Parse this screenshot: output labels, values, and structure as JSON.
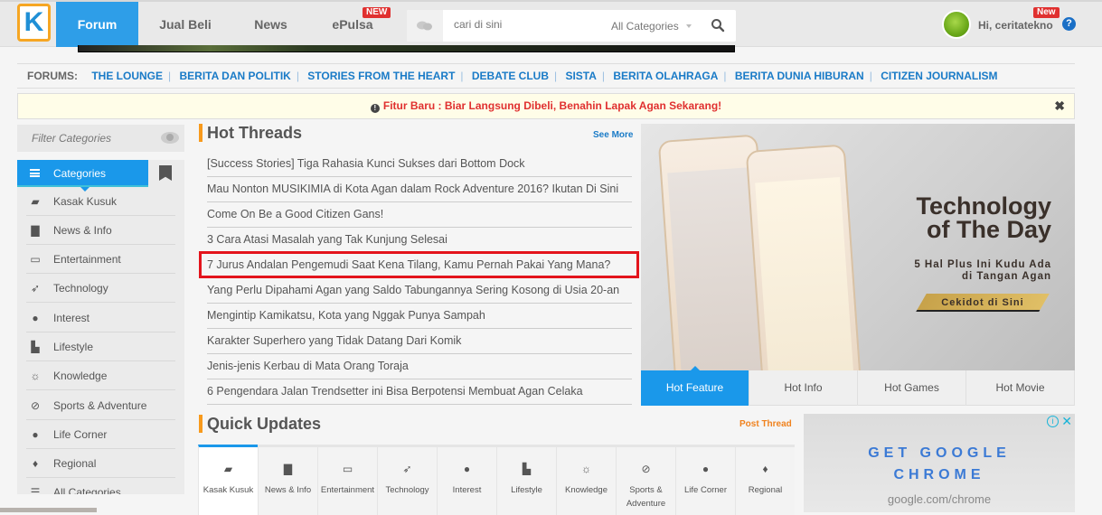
{
  "header": {
    "logo": "K",
    "nav": [
      {
        "label": "Forum",
        "active": true
      },
      {
        "label": "Jual Beli"
      },
      {
        "label": "News"
      },
      {
        "label": "ePulsa",
        "badge": "NEW"
      }
    ],
    "search": {
      "placeholder": "cari di sini",
      "category": "All Categories"
    },
    "user": {
      "greeting": "Hi, ceritatekno",
      "badge": "New",
      "help": "?"
    }
  },
  "forums": {
    "label": "FORUMS:",
    "links": [
      "THE LOUNGE",
      "BERITA DAN POLITIK",
      "STORIES FROM THE HEART",
      "DEBATE CLUB",
      "SISTA",
      "BERITA OLAHRAGA",
      "BERITA DUNIA HIBURAN",
      "CITIZEN JOURNALISM"
    ]
  },
  "notice": {
    "text": "Fitur Baru : Biar Langsung Dibeli, Benahin Lapak Agan Sekarang!",
    "close": "✖"
  },
  "sidebar": {
    "filter_placeholder": "Filter Categories",
    "header": "Categories",
    "items": [
      {
        "label": "Kasak Kusuk",
        "icon": "chat-icon"
      },
      {
        "label": "News & Info",
        "icon": "briefcase-icon"
      },
      {
        "label": "Entertainment",
        "icon": "tv-icon"
      },
      {
        "label": "Technology",
        "icon": "rocket-icon"
      },
      {
        "label": "Interest",
        "icon": "palette-icon"
      },
      {
        "label": "Lifestyle",
        "icon": "hat-icon"
      },
      {
        "label": "Knowledge",
        "icon": "lightbulb-icon"
      },
      {
        "label": "Sports & Adventure",
        "icon": "compass-icon"
      },
      {
        "label": "Life Corner",
        "icon": "apple-icon"
      },
      {
        "label": "Regional",
        "icon": "map-pin-icon"
      },
      {
        "label": "All Categories",
        "icon": "list-icon"
      }
    ]
  },
  "hot_threads": {
    "title": "Hot Threads",
    "see_more": "See More",
    "items": [
      "[Success Stories] Tiga Rahasia Kunci Sukses dari Bottom Dock",
      "Mau Nonton MUSIKIMIA di Kota Agan dalam Rock Adventure 2016? Ikutan Di Sini",
      "Come On Be a Good Citizen Gans!",
      "3 Cara Atasi Masalah yang Tak Kunjung Selesai",
      "7 Jurus Andalan Pengemudi Saat Kena Tilang, Kamu Pernah Pakai Yang Mana?",
      "Yang Perlu Dipahami Agan yang Saldo Tabungannya Sering Kosong di Usia 20-an",
      "Mengintip Kamikatsu, Kota yang Nggak Punya Sampah",
      "Karakter Superhero yang Tidak Datang Dari Komik",
      "Jenis-jenis Kerbau di Mata Orang Toraja",
      "6 Pengendara Jalan Trendsetter ini Bisa Berpotensi Membuat Agan Celaka"
    ],
    "highlighted_index": 4
  },
  "hero": {
    "title_line1": "Technology",
    "title_line2": "of The Day",
    "subtitle_line1": "5 Hal Plus Ini Kudu Ada",
    "subtitle_line2": "di Tangan Agan",
    "cta": "Cekidot di Sini",
    "tabs": [
      "Hot Feature",
      "Hot Info",
      "Hot Games",
      "Hot Movie"
    ]
  },
  "quick_updates": {
    "title": "Quick Updates",
    "post_thread": "Post Thread",
    "tabs": [
      "Kasak Kusuk",
      "News & Info",
      "Entertainment",
      "Technology",
      "Interest",
      "Lifestyle",
      "Knowledge",
      "Sports & Adventure",
      "Life Corner",
      "Regional"
    ]
  },
  "ad": {
    "line1": "GET GOOGLE",
    "line2": "CHROME",
    "url": "google.com/chrome"
  },
  "colors": {
    "accent_blue": "#1a98ea",
    "accent_orange": "#f89a1c",
    "alert_red": "#e0302f",
    "link_blue": "#1a7bc7"
  }
}
